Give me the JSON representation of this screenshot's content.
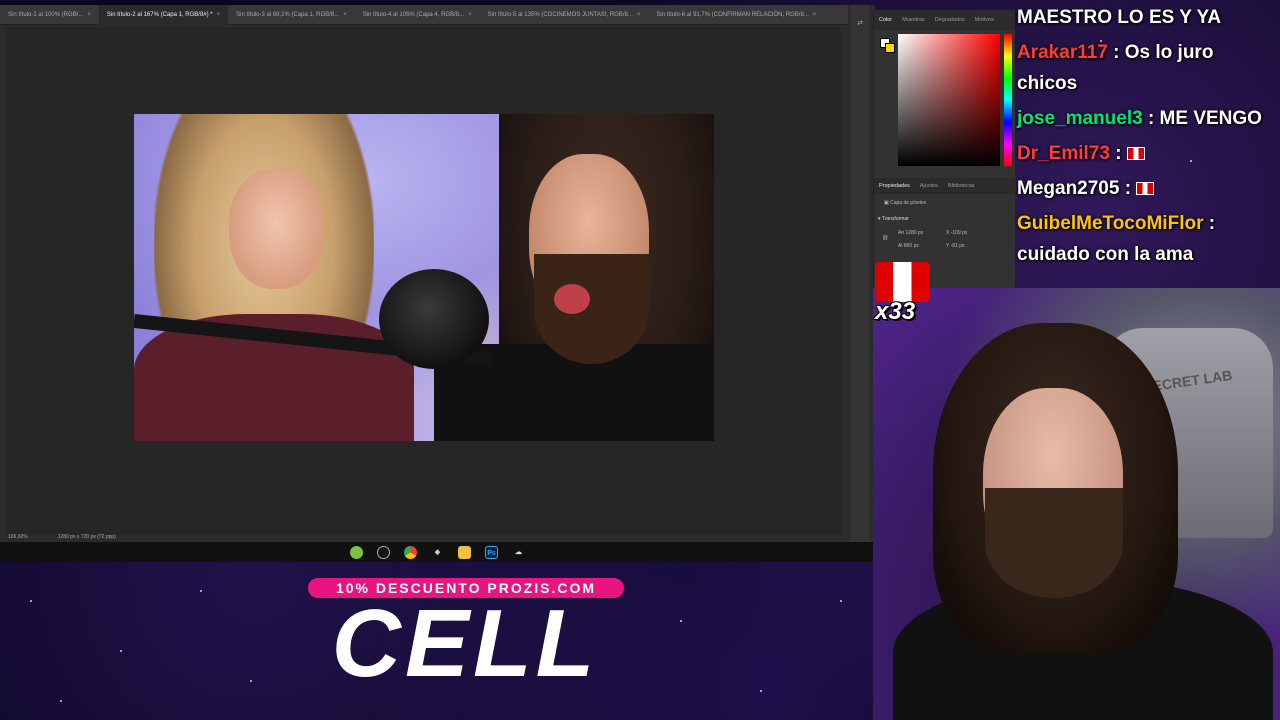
{
  "photoshop": {
    "tabs": [
      {
        "label": "Sin título-1 al 100% (RGB/...",
        "active": false
      },
      {
        "label": "Sin título-2 al 167% (Capa 1, RGB/8#) *",
        "active": true
      },
      {
        "label": "Sin título-3 al 69,1% (Capa 1, RGB/8...",
        "active": false
      },
      {
        "label": "Sin título-4 al 105% (Capa 4, RGB/8...",
        "active": false
      },
      {
        "label": "Sin título-5 al 135% (COCINEMOS JUNTAS!, RGB/8...",
        "active": false
      },
      {
        "label": "Sin título-6 al 91,7% (CONFIRMAN RELACIÓN, RGB/8...",
        "active": false
      }
    ],
    "status_zoom": "166,92%",
    "status_doc": "1280 px x 720 px (72 ppp)",
    "panel": {
      "color_tabs": [
        "Color",
        "Muestras",
        "Degradados",
        "Motivos"
      ],
      "props_tabs": [
        "Propiedades",
        "Ajustes",
        "Bibliotecas"
      ],
      "layer_type": "Capa de píxeles",
      "transform_label": "Transformar",
      "width_label": "An",
      "width_value": "1280 px",
      "height_label": "Al",
      "height_value": "860 px",
      "x_label": "X",
      "x_value": "-109 px",
      "y_label": "Y",
      "y_value": "-81 px"
    }
  },
  "taskbar": {
    "icons": [
      "app-green-icon",
      "clock-icon",
      "chrome-icon",
      "tool-icon",
      "folder-icon",
      "photoshop-icon",
      "cloud-icon"
    ]
  },
  "chat": {
    "lines": [
      {
        "user": "",
        "message": "MAESTRO LO ES Y YA",
        "color": "#ffffff"
      },
      {
        "user": "Arakar117",
        "message": ": Os lo juro",
        "color": "#ff3b3b"
      },
      {
        "user": "",
        "message": "chicos",
        "color": "#ffffff"
      },
      {
        "user": "jose_manuel3",
        "message": ": ME VENGO",
        "color": "#00e676"
      },
      {
        "user": "Dr_Emil73",
        "message": ":",
        "color": "#ff3b3b",
        "flag": true
      },
      {
        "user": "Megan2705",
        "message": ":",
        "color": "#ffffff",
        "flag": true
      },
      {
        "user": "GuibelMeTocoMiFlor",
        "message": ":",
        "color": "#ffc400"
      },
      {
        "user": "",
        "message": "cuidado con la ama",
        "color": "#ffffff"
      }
    ]
  },
  "alert": {
    "count": "x33"
  },
  "promo": {
    "badge": "10% DESCUENTO PROZIS.COM",
    "headline": "CELL"
  },
  "webcam": {
    "chair_logo": "SECRET LAB"
  }
}
